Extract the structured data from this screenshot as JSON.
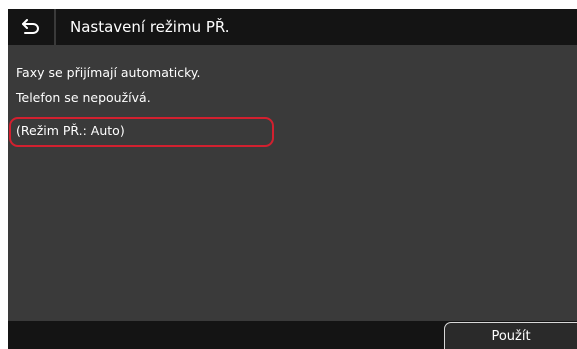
{
  "header": {
    "title": "Nastavení režimu PŘ.",
    "back_icon": "back-arrow-icon"
  },
  "content": {
    "lines": [
      "Faxy se přijímají automaticky.",
      "Telefon se nepoužívá.",
      "(Režim PŘ.: Auto)"
    ],
    "highlight_color": "#d2202f"
  },
  "footer": {
    "apply_label": "Použít"
  },
  "colors": {
    "bar": "#141414",
    "panel": "#3a3a3a",
    "text": "#ffffff"
  }
}
